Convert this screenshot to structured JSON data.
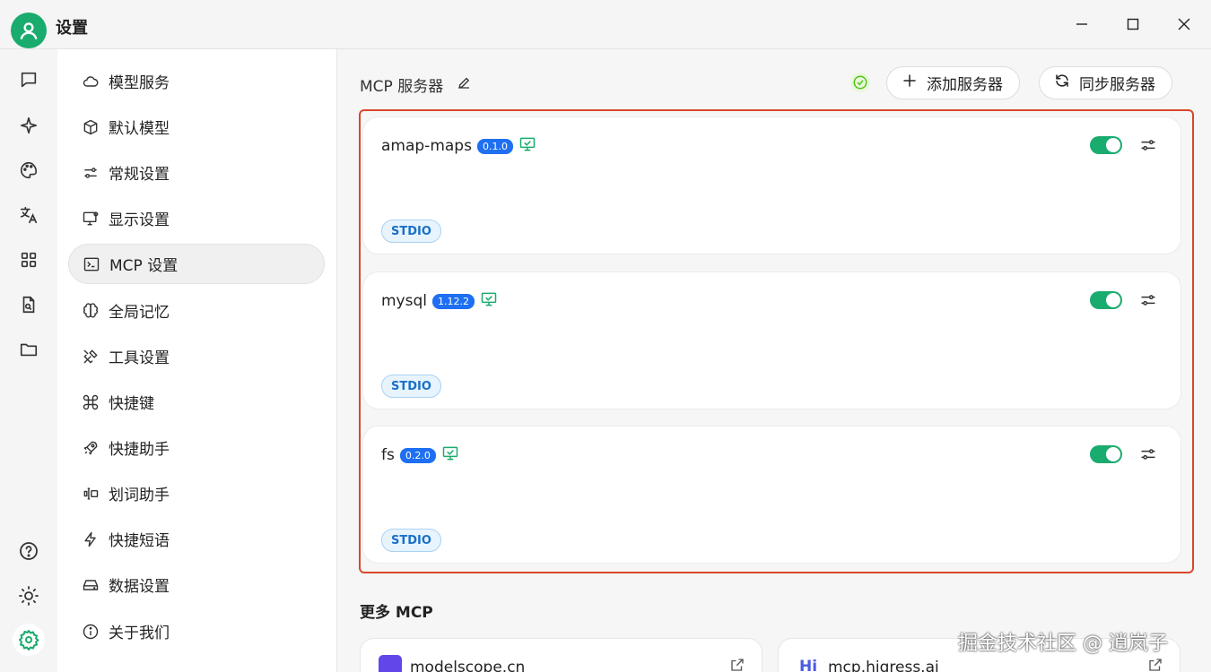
{
  "window": {
    "title": "设置"
  },
  "menu": {
    "items": [
      {
        "label": "模型服务",
        "icon": "cloud-icon"
      },
      {
        "label": "默认模型",
        "icon": "cube-icon"
      },
      {
        "label": "常规设置",
        "icon": "sliders-icon"
      },
      {
        "label": "显示设置",
        "icon": "monitor-settings-icon"
      },
      {
        "label": "MCP 设置",
        "icon": "terminal-icon"
      },
      {
        "label": "全局记忆",
        "icon": "brain-icon"
      },
      {
        "label": "工具设置",
        "icon": "tools-icon"
      },
      {
        "label": "快捷键",
        "icon": "command-icon"
      },
      {
        "label": "快捷助手",
        "icon": "rocket-icon"
      },
      {
        "label": "划词助手",
        "icon": "text-select-icon"
      },
      {
        "label": "快捷短语",
        "icon": "zap-icon"
      },
      {
        "label": "数据设置",
        "icon": "hard-drive-icon"
      },
      {
        "label": "关于我们",
        "icon": "info-icon"
      }
    ],
    "active_index": 4
  },
  "content": {
    "title": "MCP 服务器",
    "add_button": "添加服务器",
    "sync_button": "同步服务器",
    "servers": [
      {
        "name": "amap-maps",
        "version": "0.1.0",
        "type": "STDIO",
        "enabled": true
      },
      {
        "name": "mysql",
        "version": "1.12.2",
        "type": "STDIO",
        "enabled": true
      },
      {
        "name": "fs",
        "version": "0.2.0",
        "type": "STDIO",
        "enabled": true
      }
    ],
    "more_title": "更多 MCP",
    "sites": [
      {
        "name": "modelscope.cn"
      },
      {
        "name": "mcp.higress.ai"
      }
    ]
  },
  "watermark": "掘金技术社区 @ 逍岚子",
  "colors": {
    "accent": "#1aab6e",
    "version_badge": "#1e6ff2",
    "highlight_border": "#d9472b"
  }
}
